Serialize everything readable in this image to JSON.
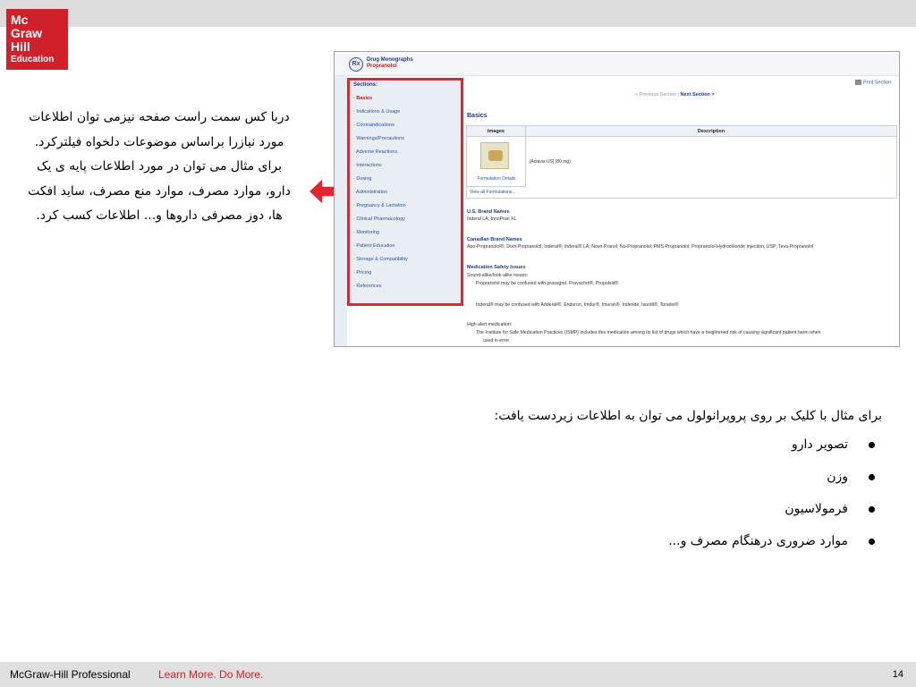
{
  "logo": {
    "line1": "Mc",
    "line2": "Graw",
    "line3": "Hill",
    "line4": "Education"
  },
  "left_text": "دربا کس سمت راست صفحه نیزمی توان اطلاعات مورد نیازرا براساس موضوعات دلخواه فیلترکرد. برای مثال می توان در مورد اطلاعات پایه ی یک دارو، موارد مصرف، موارد منع مصرف، ساید افکت ها، دوز مصرفی داروها و... اطلاعات کسب کرد.",
  "screenshot": {
    "header_title": "Drug Monographs",
    "header_sub": "Propranolol",
    "rx_symbol": "Rx",
    "sections_title": "Sections:",
    "sections": [
      "· Basics",
      "· Indications & Usage",
      "· Contraindications",
      "· Warnings/Precautions",
      "· Adverse Reactions",
      "· Interactions",
      "· Dosing",
      "· Administration",
      "· Pregnancy & Lactation",
      "· Clinical Pharmacology",
      "· Monitoring",
      "· Patient Education",
      "· Storage & Compatibility",
      "· Pricing",
      "· References"
    ],
    "print_section": "Print Section",
    "prev_section": "< Previous Section",
    "pager_sep": "|",
    "next_section": "Next Section >",
    "basics_title": "Basics",
    "table": {
      "col_images": "Images",
      "col_description": "Description",
      "formulation_details": "Formulation Details",
      "description_value": "[Actavis US] (80 mg)",
      "view_all": "View all Formulations..."
    },
    "us_brand_title": "U.S. Brand Names",
    "us_brand_value": "Inderal LA; InnoPran XL",
    "ca_brand_title": "Canadian Brand Names",
    "ca_brand_value": "Apo-Propranolol®; Dom-Propranolol; Inderal®; Inderal® LA; Novo-Pranol; Nu-Propranolol; PMS-Propranolol; Propranolol Hydrochloride Injection, USP; Teva-Propranolol",
    "safety_title": "Medication Safety Issues",
    "safety_line1": "Sound-alike/look-alike issues:",
    "safety_line2": "Propranolol may be confused with prasugrel, Pravachol®, Propulsid®",
    "safety_line3": "Inderal® may be confused with Adderall®, Enduron, Imdur®, Imuran®, Inderide, Isordil®, Toradol®",
    "high_alert_line1": "High alert medication:",
    "high_alert_line2": "The Institute for Safe Medication Practices (ISMP) includes this medication among its list of drugs which have a heightened risk of causing significant patient harm when",
    "high_alert_line3": "used in error."
  },
  "right_text": {
    "intro": "برای مثال با کلیک بر روی پروپرانولول می توان به اطلاعات زیردست یافت:",
    "bullets": [
      "تصویر دارو",
      "وزن",
      "فرمولاسیون",
      "موارد ضروری درهنگام مصرف و..."
    ]
  },
  "footer": {
    "brand": "McGraw-Hill Professional",
    "tagline": "Learn More. Do More.",
    "page_number": "14"
  },
  "colors": {
    "accent_red": "#d0202a",
    "highlight_red": "#e3262b",
    "link_blue": "#2a54a6"
  },
  "icons": [
    "rx-icon",
    "print-icon",
    "arrow-left-icon",
    "bullet-icon"
  ]
}
